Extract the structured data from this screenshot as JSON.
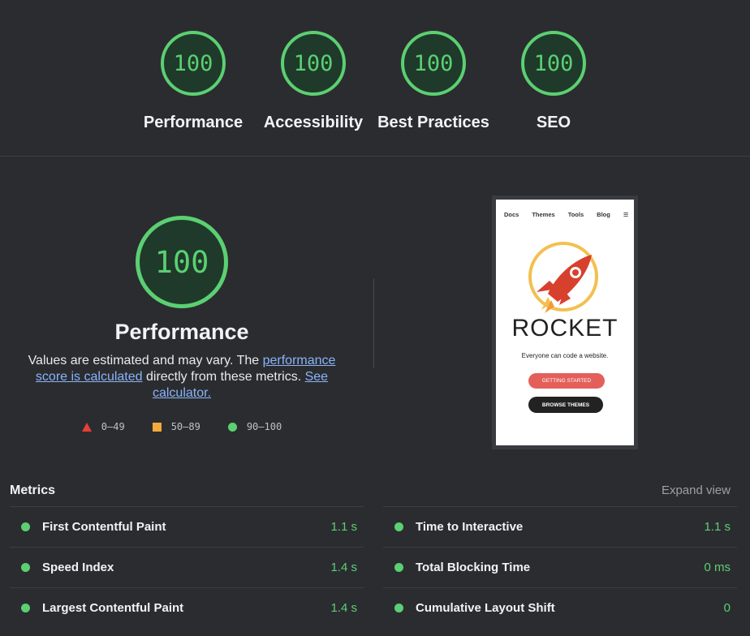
{
  "categories": [
    {
      "score": "100",
      "label": "Performance"
    },
    {
      "score": "100",
      "label": "Accessibility"
    },
    {
      "score": "100",
      "label": "Best Practices"
    },
    {
      "score": "100",
      "label": "SEO"
    }
  ],
  "performance": {
    "score": "100",
    "title": "Performance",
    "desc_1": "Values are estimated and may vary. The ",
    "link_1": "performance score is calculated",
    "desc_2": " directly from these metrics. ",
    "link_2": "See calculator.",
    "legend": {
      "fail": "0–49",
      "average": "50–89",
      "pass": "90–100"
    }
  },
  "screenshot": {
    "nav": [
      "Docs",
      "Themes",
      "Tools",
      "Blog"
    ],
    "menu_icon": "≡",
    "brand": "ROCKET",
    "tagline": "Everyone can code a website.",
    "primary_button": "GETTING STARTED",
    "secondary_button": "BROWSE THEMES"
  },
  "metrics": {
    "title": "Metrics",
    "expand_label": "Expand view",
    "left": [
      {
        "name": "First Contentful Paint",
        "value": "1.1 s"
      },
      {
        "name": "Speed Index",
        "value": "1.4 s"
      },
      {
        "name": "Largest Contentful Paint",
        "value": "1.4 s"
      }
    ],
    "right": [
      {
        "name": "Time to Interactive",
        "value": "1.1 s"
      },
      {
        "name": "Total Blocking Time",
        "value": "0 ms"
      },
      {
        "name": "Cumulative Layout Shift",
        "value": "0"
      }
    ]
  },
  "colors": {
    "pass": "#5bd072",
    "average": "#f4a93b",
    "fail": "#e63f3a",
    "link": "#8ab4f8"
  }
}
